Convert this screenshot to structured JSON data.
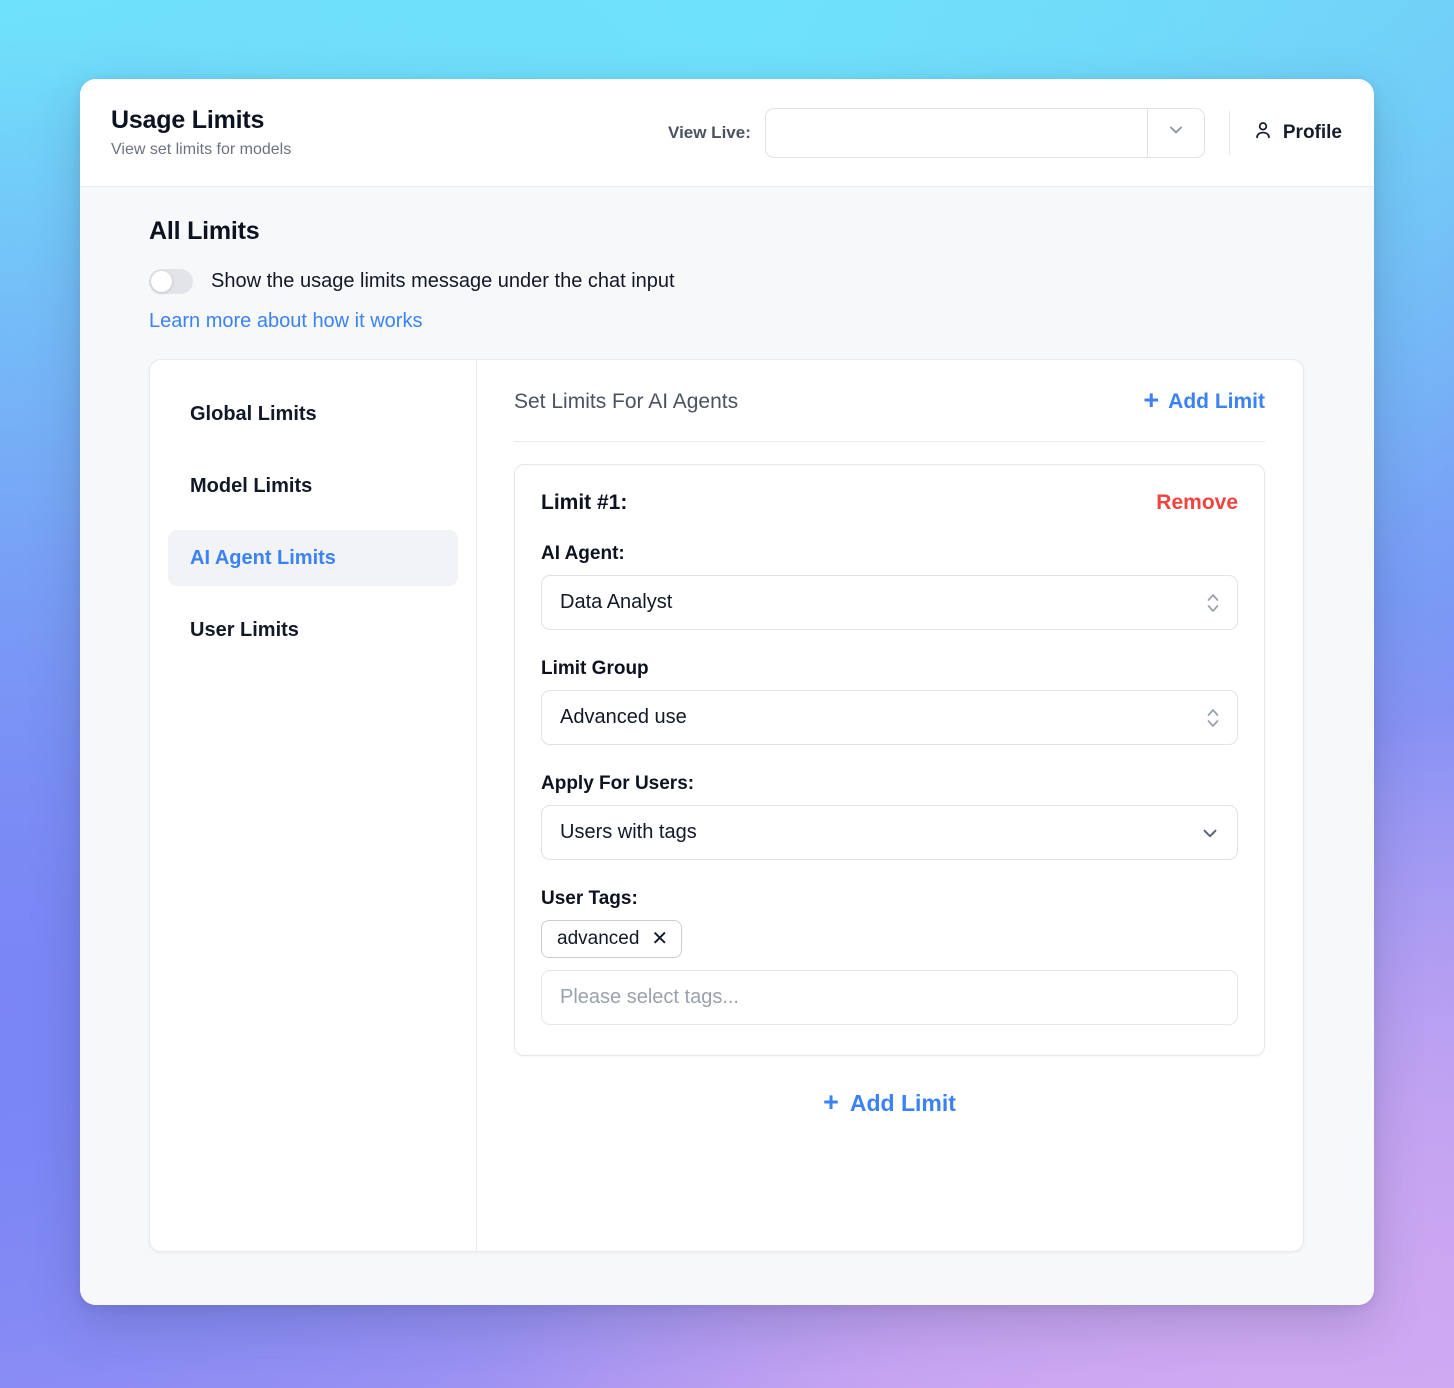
{
  "header": {
    "title": "Usage Limits",
    "subtitle": "View set limits for models",
    "view_live_label": "View Live:",
    "view_live_value": "",
    "view_live_placeholder": "",
    "profile_label": "Profile"
  },
  "section": {
    "title": "All Limits",
    "toggle_label": "Show the usage limits message under the chat input",
    "toggle_on": false,
    "learn_more_link": "Learn more about how it works"
  },
  "sidebar": {
    "items": [
      {
        "label": "Global Limits",
        "active": false
      },
      {
        "label": "Model Limits",
        "active": false
      },
      {
        "label": "AI Agent Limits",
        "active": true
      },
      {
        "label": "User Limits",
        "active": false
      }
    ]
  },
  "content": {
    "title": "Set Limits For AI Agents",
    "add_limit_top": "Add Limit",
    "add_limit_bottom": "Add Limit"
  },
  "limit": {
    "heading": "Limit #1:",
    "remove_label": "Remove",
    "agent_label": "AI Agent:",
    "agent_value": "Data Analyst",
    "group_label": "Limit Group",
    "group_value": "Advanced use",
    "apply_label": "Apply For Users:",
    "apply_value": "Users with tags",
    "tags_label": "User Tags:",
    "tags": [
      "advanced"
    ],
    "tags_placeholder": "Please select tags..."
  },
  "colors": {
    "accent_blue": "#3b82f6",
    "danger_red": "#f0453f",
    "text_dark": "#0d1220",
    "text_muted": "#6b7280",
    "panel_bg": "#f7f8fa"
  }
}
